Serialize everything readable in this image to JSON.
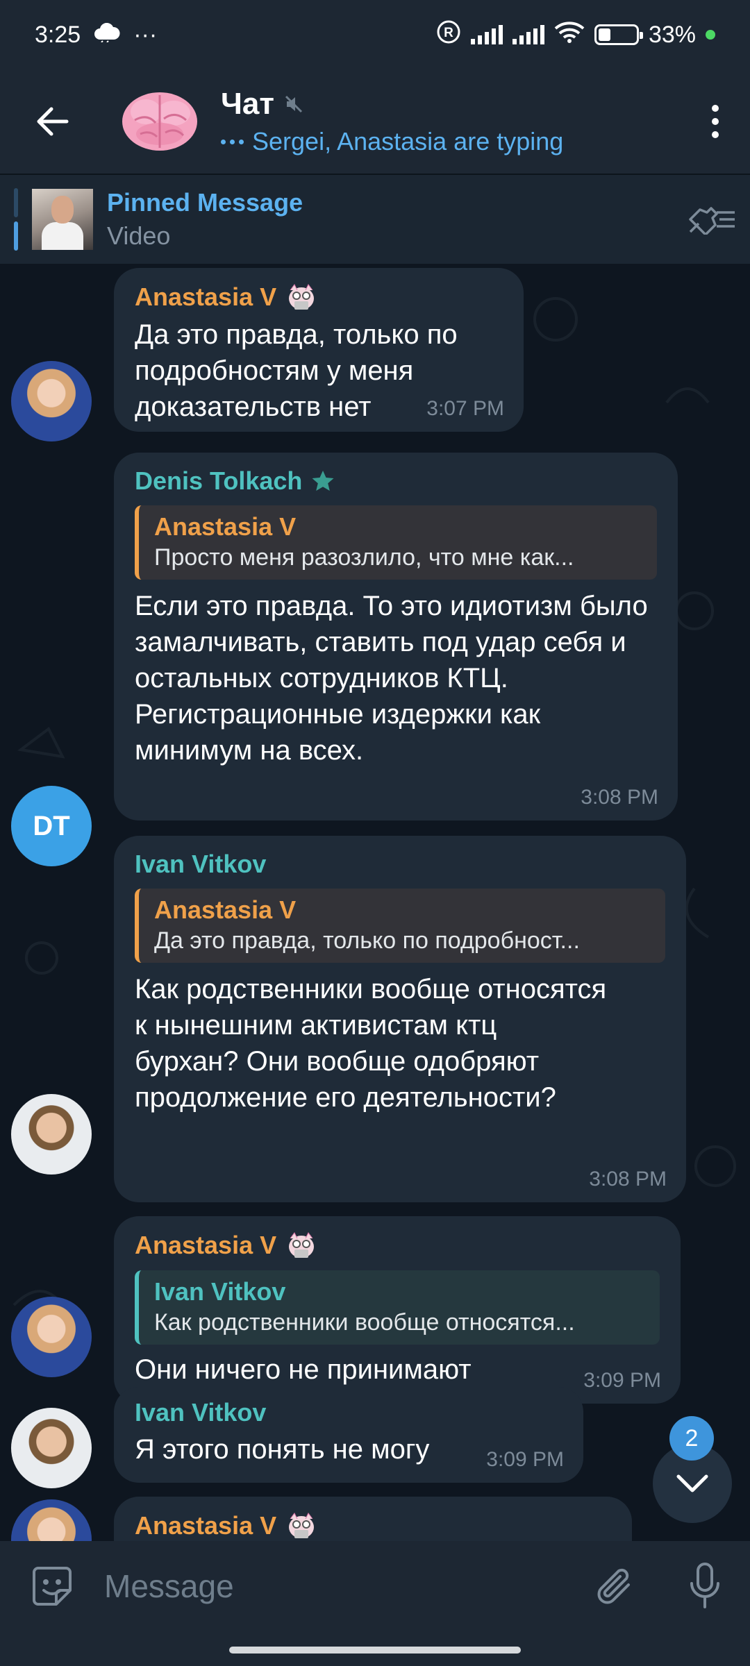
{
  "status_bar": {
    "time": "3:25",
    "more": "···",
    "battery_percent": "33%",
    "battery_level": 0.33
  },
  "header": {
    "title": "Чат",
    "typing_status": "Sergei, Anastasia are typing"
  },
  "pinned": {
    "title": "Pinned Message",
    "subtitle": "Video"
  },
  "messages": [
    {
      "sender": "Anastasia V",
      "text": "Да это правда, только по подробностям у меня доказательств нет",
      "time": "3:07 PM"
    },
    {
      "sender": "Denis Tolkach",
      "avatar_initials": "DT",
      "reply_to": {
        "name": "Anastasia V",
        "text": "Просто меня разозлило, что мне как..."
      },
      "text": "Если это правда. То это идиотизм было замалчивать, ставить под удар себя и остальных сотрудников КТЦ. Регистрационные издержки как минимум на всех.",
      "time": "3:08 PM"
    },
    {
      "sender": "Ivan Vitkov",
      "reply_to": {
        "name": "Anastasia V",
        "text": "Да это правда, только по подробност..."
      },
      "text": "Как родственники вообще относятся к нынешним активистам ктц бурхан? Они вообще одобряют продолжение его деятельности?",
      "time": "3:08 PM"
    },
    {
      "sender": "Anastasia V",
      "reply_to": {
        "name": "Ivan Vitkov",
        "text": "Как родственники вообще относятся..."
      },
      "text": "Они ничего не принимают",
      "time": "3:09 PM"
    },
    {
      "sender": "Ivan Vitkov",
      "text": "Я этого понять не могу",
      "time": "3:09 PM"
    },
    {
      "sender": "Anastasia V"
    }
  ],
  "scroll_down": {
    "unread_count": "2"
  },
  "input": {
    "placeholder": "Message"
  },
  "colors": {
    "accent": "#5cb2f0",
    "orange_name": "#f0a14a",
    "teal_name": "#4fc2c0",
    "bubble": "#1f2b38",
    "background": "#0e1620"
  }
}
